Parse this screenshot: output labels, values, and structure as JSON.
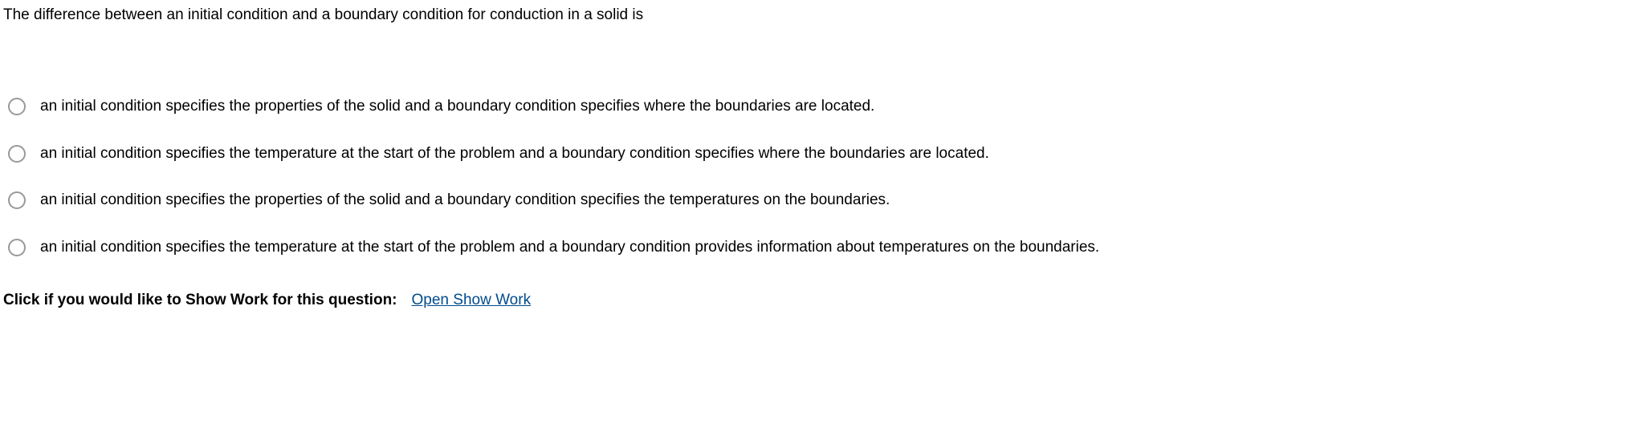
{
  "question": {
    "text": "The difference between an initial condition and a boundary condition for conduction in a solid is"
  },
  "options": [
    {
      "text": "an initial condition specifies the properties of the solid and a boundary condition specifies where the boundaries are located."
    },
    {
      "text": "an initial condition specifies the temperature at the start of the problem and a boundary condition specifies where the boundaries are located."
    },
    {
      "text": "an initial condition specifies the properties of the solid and a boundary condition specifies the temperatures on the boundaries."
    },
    {
      "text": "an initial condition specifies the temperature at the start of the problem and a boundary condition provides information about temperatures on the boundaries."
    }
  ],
  "showWork": {
    "label": "Click if you would like to Show Work for this question:",
    "linkText": "Open Show Work"
  }
}
